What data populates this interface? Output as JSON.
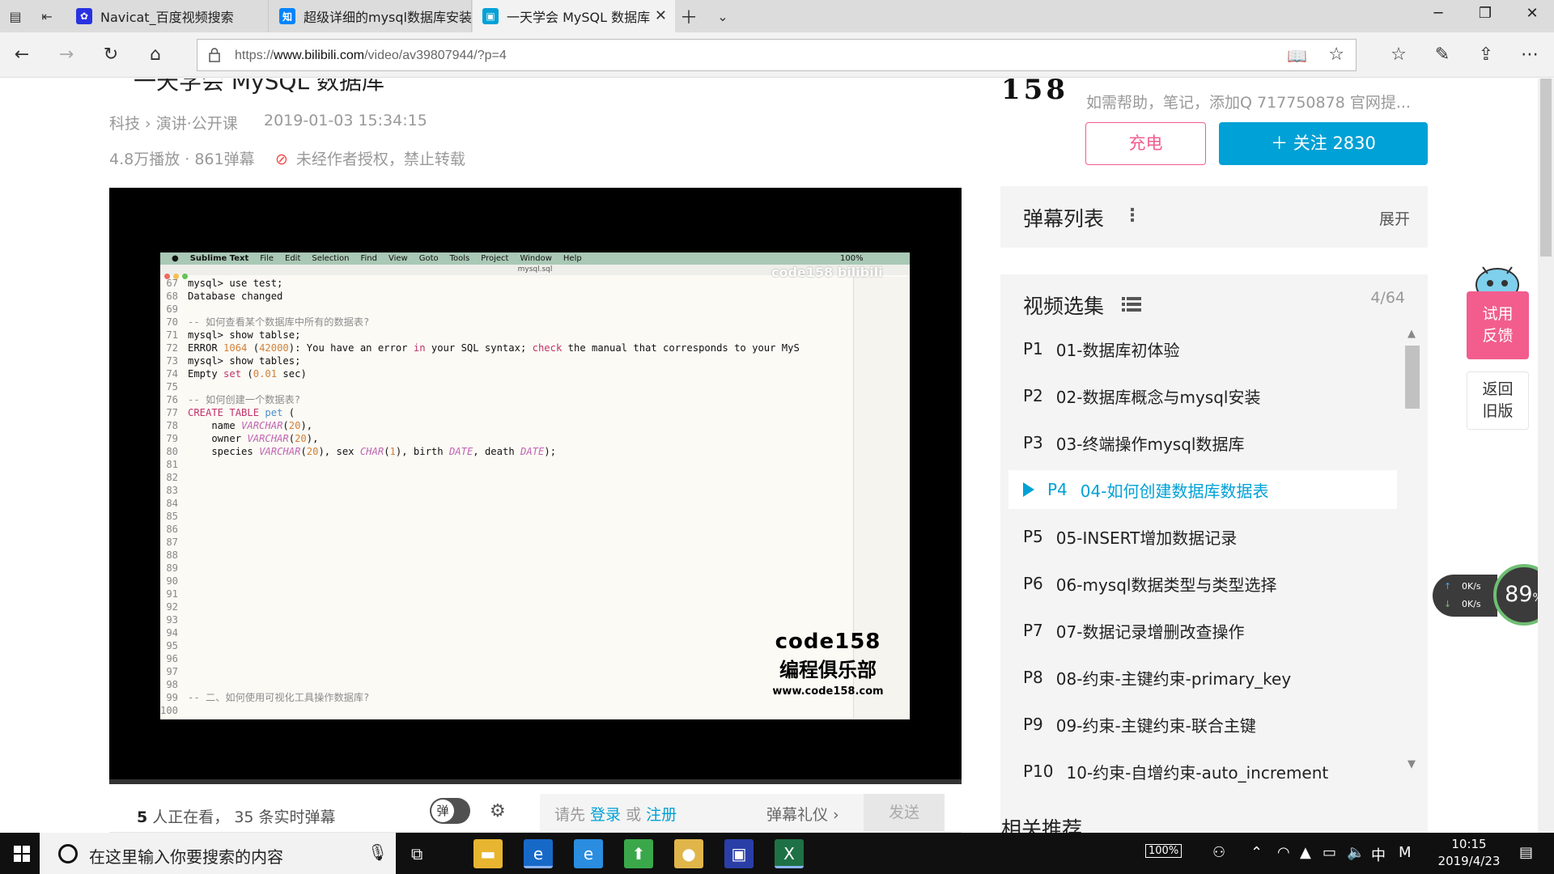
{
  "browser": {
    "tabs": [
      {
        "title": "Navicat_百度视频搜索",
        "favicon": "baidu-paw-icon",
        "color": "#2932e1",
        "active": false
      },
      {
        "title": "超级详细的mysql数据库安装",
        "favicon": "zhihu-icon",
        "color": "#0084ff",
        "active": false
      },
      {
        "title": "一天学会 MySQL 数据库",
        "favicon": "bilibili-tv-icon",
        "color": "#00a1d6",
        "active": true
      }
    ],
    "url_prefix": "https://",
    "url_domain": "www.bilibili.com",
    "url_path": "/video/av39807944/?p=4"
  },
  "video": {
    "title": "一天学会 MySQL 数据库",
    "category_main": "科技",
    "category_sub": "演讲·公开课",
    "date": "2019-01-03 15:34:15",
    "stats": "4.8万播放 · 861弹幕",
    "copyright": "未经作者授权，禁止转载"
  },
  "sublime": {
    "menu": [
      "Sublime Text",
      "File",
      "Edit",
      "Selection",
      "Find",
      "View",
      "Goto",
      "Tools",
      "Project",
      "Window",
      "Help"
    ],
    "battery": "100%",
    "filename": "mysql.sql",
    "watermark_top": "code158 bilibili",
    "watermark_brand": "code158",
    "watermark_club": "编程俱乐部",
    "watermark_site": "www.code158.com",
    "lines": [
      {
        "n": "67",
        "html": "mysql&gt; use test;"
      },
      {
        "n": "68",
        "html": "Database changed"
      },
      {
        "n": "69",
        "html": ""
      },
      {
        "n": "70",
        "html": "<span class='cm'>-- 如何查看某个数据库中所有的数据表?</span>"
      },
      {
        "n": "71",
        "html": "mysql&gt; show tablse;"
      },
      {
        "n": "72",
        "html": "ERROR <span class='nu'>1064</span> (<span class='nu'>42000</span>): You have an error <span class='kw'>in</span> your SQL syntax; <span class='kw'>check</span> the manual that corresponds to your MyS"
      },
      {
        "n": "73",
        "html": "mysql&gt; show tables;"
      },
      {
        "n": "74",
        "html": "Empty <span class='kw'>set</span> (<span class='nu'>0.01</span> sec)"
      },
      {
        "n": "75",
        "html": ""
      },
      {
        "n": "76",
        "html": "<span class='cm'>-- 如何创建一个数据表?</span>"
      },
      {
        "n": "77",
        "html": "<span class='kw'>CREATE TABLE</span> <span class='fn'>pet</span> ("
      },
      {
        "n": "78",
        "html": "    name <span class='ty'>VARCHAR</span>(<span class='nu'>20</span>),"
      },
      {
        "n": "79",
        "html": "    owner <span class='ty'>VARCHAR</span>(<span class='nu'>20</span>),"
      },
      {
        "n": "80",
        "html": "    species <span class='ty'>VARCHAR</span>(<span class='nu'>20</span>), sex <span class='ty'>CHAR</span>(<span class='nu'>1</span>), birth <span class='ty'>DATE</span>, death <span class='ty'>DATE</span>);"
      },
      {
        "n": "81",
        "html": ""
      },
      {
        "n": "82",
        "html": ""
      },
      {
        "n": "83",
        "html": ""
      },
      {
        "n": "84",
        "html": ""
      },
      {
        "n": "85",
        "html": ""
      },
      {
        "n": "86",
        "html": ""
      },
      {
        "n": "87",
        "html": ""
      },
      {
        "n": "88",
        "html": ""
      },
      {
        "n": "89",
        "html": ""
      },
      {
        "n": "90",
        "html": ""
      },
      {
        "n": "91",
        "html": ""
      },
      {
        "n": "92",
        "html": ""
      },
      {
        "n": "93",
        "html": ""
      },
      {
        "n": "94",
        "html": ""
      },
      {
        "n": "95",
        "html": ""
      },
      {
        "n": "96",
        "html": ""
      },
      {
        "n": "97",
        "html": ""
      },
      {
        "n": "98",
        "html": ""
      },
      {
        "n": "99",
        "html": "<span class='cm'>-- 二、如何使用可视化工具操作数据库?</span>"
      },
      {
        "n": "100",
        "html": ""
      }
    ]
  },
  "danmaku": {
    "viewers": "5",
    "viewers_text": " 人正在看， ",
    "live": "35",
    "live_text": " 条实时弹幕",
    "toggle_label": "弹",
    "hint_prefix": "请先 ",
    "login": "登录",
    "or": " 或 ",
    "register": "注册",
    "etiquette": "弹幕礼仪 ›",
    "send": "发送"
  },
  "uploader": {
    "number_logo": "158",
    "desc": "如需帮助，笔记，添加Q 717750878 官网提...",
    "charge": "充电",
    "follow": "＋ 关注 2830"
  },
  "danmaku_list": {
    "title": "弹幕列表",
    "expand": "展开"
  },
  "episodes": {
    "title": "视频选集",
    "count": "4/64",
    "items": [
      {
        "p": "P1",
        "name": "01-数据库初体验",
        "active": false
      },
      {
        "p": "P2",
        "name": "02-数据库概念与mysql安装",
        "active": false
      },
      {
        "p": "P3",
        "name": "03-终端操作mysql数据库",
        "active": false
      },
      {
        "p": "P4",
        "name": "04-如何创建数据库数据表",
        "active": true
      },
      {
        "p": "P5",
        "name": "05-INSERT增加数据记录",
        "active": false
      },
      {
        "p": "P6",
        "name": "06-mysql数据类型与类型选择",
        "active": false
      },
      {
        "p": "P7",
        "name": "07-数据记录增删改查操作",
        "active": false
      },
      {
        "p": "P8",
        "name": "08-约束-主键约束-primary_key",
        "active": false
      },
      {
        "p": "P9",
        "name": "09-约束-主键约束-联合主键",
        "active": false
      },
      {
        "p": "P10",
        "name": "10-约束-自增约束-auto_increment",
        "active": false
      }
    ]
  },
  "related": "相关推荐",
  "float_buttons": {
    "feedback": [
      "试用",
      "反馈"
    ],
    "old": [
      "返回",
      "旧版"
    ]
  },
  "netmon": {
    "up": "0K/s",
    "down": "0K/s",
    "percent": "89",
    "unit": "%"
  },
  "taskbar": {
    "search_placeholder": "在这里输入你要搜索的内容",
    "battery": "100%",
    "ime": "中",
    "ime2": "M",
    "time": "10:15",
    "date": "2019/4/23"
  },
  "colors": {
    "accent": "#00a1d6",
    "pink": "#f25d8e"
  }
}
